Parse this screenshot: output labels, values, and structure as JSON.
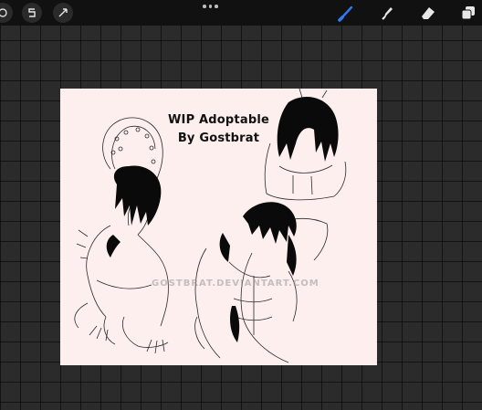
{
  "toolbar": {
    "left_tools": [
      "adjustments-icon",
      "selection-icon",
      "transform-icon"
    ],
    "right_tools": [
      "brush-icon",
      "smudge-icon",
      "eraser-icon",
      "layers-icon"
    ],
    "active_tool": "brush-icon",
    "accent_color": "#2f7cf6"
  },
  "canvas": {
    "title_line1": "WIP Adoptable",
    "title_line2": "By Gostbrat",
    "watermark": "GOSTBRAT.DEVIANTART.COM",
    "background_color": "#fcefee"
  }
}
